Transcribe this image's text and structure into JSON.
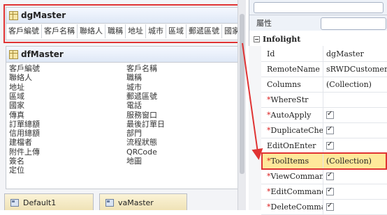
{
  "dgMaster": {
    "title": "dgMaster",
    "columns": [
      "客戶編號",
      "客戶名稱",
      "聯絡人",
      "職稱",
      "地址",
      "城市",
      "區域",
      "郵遞區號",
      "國家"
    ]
  },
  "dfMaster": {
    "title": "dfMaster",
    "fields_left": [
      "客戶編號",
      "聯絡人",
      "地址",
      "區域",
      "國家",
      "傳真",
      "訂單總額",
      "信用總額",
      "建檔者",
      "附件上傳",
      "簽名",
      "定位"
    ],
    "fields_right": [
      "客戶名稱",
      "職稱",
      "城市",
      "郵遞區號",
      "電話",
      "服務窗口",
      "最後訂單日",
      "部門",
      "流程狀態",
      "QRCode",
      "地圖"
    ]
  },
  "tabs": [
    {
      "label": "Default1"
    },
    {
      "label": "vaMaster"
    }
  ],
  "properties": {
    "header_title": "屬性",
    "category": "Infolight",
    "rows": [
      {
        "name": "Id",
        "required": false,
        "value": "dgMaster",
        "type": "text"
      },
      {
        "name": "RemoteName",
        "required": false,
        "value": "sRWDCustomers.Cu",
        "type": "text"
      },
      {
        "name": "Columns",
        "required": false,
        "value": "(Collection)",
        "type": "text"
      },
      {
        "name": "WhereStr",
        "required": true,
        "value": "",
        "type": "text"
      },
      {
        "name": "AutoApply",
        "required": true,
        "value": "",
        "type": "check"
      },
      {
        "name": "DuplicateCheck",
        "required": true,
        "value": "",
        "type": "check"
      },
      {
        "name": "EditOnEnter",
        "required": false,
        "value": "",
        "type": "check"
      },
      {
        "name": "ToolItems",
        "required": true,
        "value": "(Collection)",
        "type": "text",
        "highlight": true
      },
      {
        "name": "ViewCommandVis",
        "required": true,
        "value": "",
        "type": "check"
      },
      {
        "name": "EditCommandVisi",
        "required": true,
        "value": "",
        "type": "check"
      },
      {
        "name": "DeleteCommandV",
        "required": true,
        "value": "",
        "type": "check"
      }
    ]
  },
  "colors": {
    "highlight_border": "#e03333",
    "highlight_fill": "#ffe89a",
    "required_marker": "#d22"
  }
}
